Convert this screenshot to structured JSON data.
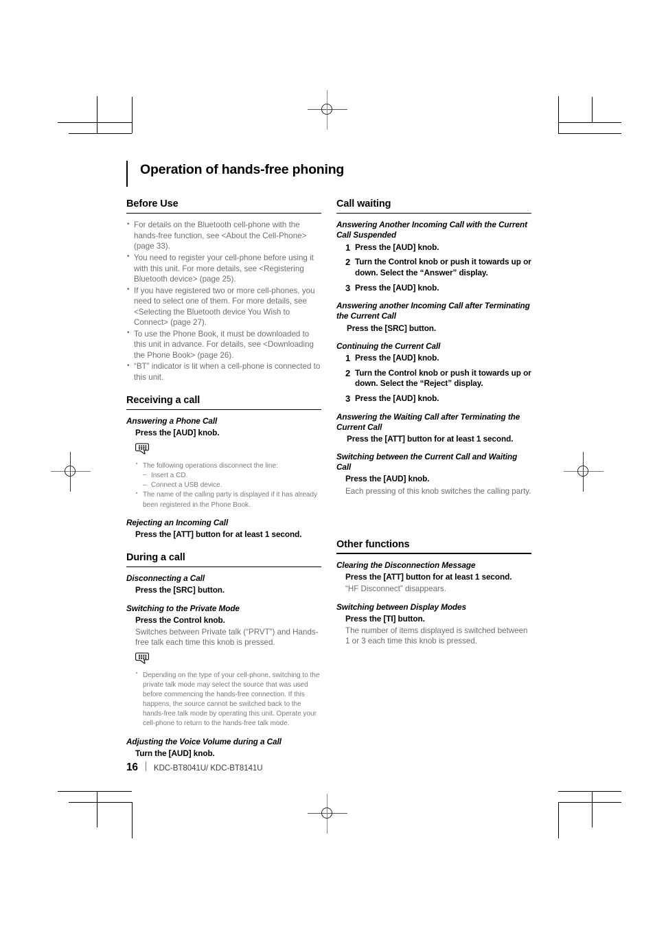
{
  "chapter": {
    "title": "Operation of hands-free phoning"
  },
  "left_column": {
    "before_use": {
      "heading": "Before Use",
      "bullets": [
        "For details on the Bluetooth cell-phone with the hands-free function, see <About the Cell-Phone> (page 33).",
        "You need to register your cell-phone before using it with this unit. For more details, see <Registering Bluetooth device> (page 25).",
        "If you have registered two or more cell-phones, you need to select one of them. For more details, see <Selecting the Bluetooth device You Wish to Connect> (page 27).",
        "To use the Phone Book, it must be downloaded to this unit in advance. For details, see <Downloading the Phone Book> (page 26).",
        "“BT” indicator is lit when a cell-phone is connected to this unit."
      ]
    },
    "receiving_a_call": {
      "heading": "Receiving a call",
      "answering": {
        "sub": "Answering a Phone Call",
        "action": "Press the [AUD] knob.",
        "note_icon": "note-speech-bubble-icon",
        "notes": [
          "The following operations disconnect the line:",
          "The name of the calling party is displayed if it has already been registered in the Phone Book."
        ],
        "note_sub_items": [
          "Insert a CD.",
          "Connect a USB device."
        ]
      },
      "rejecting": {
        "sub": "Rejecting an Incoming Call",
        "action": "Press the [ATT] button for at least 1 second."
      }
    },
    "during_a_call": {
      "heading": "During a call",
      "disconnecting": {
        "sub": "Disconnecting a Call",
        "action": "Press the [SRC] button."
      },
      "private_mode": {
        "sub": "Switching to the Private Mode",
        "action": "Press the Control knob.",
        "desc": "Switches between Private talk (“PRVT”) and Hands-free talk each time this knob is pressed.",
        "note_icon": "note-speech-bubble-icon",
        "notes": [
          "Depending on the type of your cell-phone, switching to the private talk mode may select the source that was used before commencing the hands-free connection. If this happens, the source cannot be switched back to the hands-free talk mode by operating this unit. Operate your cell-phone to return to the hands-free talk mode."
        ]
      },
      "voice_volume": {
        "sub": "Adjusting the Voice Volume during a Call",
        "action": "Turn the [AUD] knob."
      }
    }
  },
  "right_column": {
    "call_waiting": {
      "heading": "Call waiting",
      "answer_suspend": {
        "sub": "Answering Another Incoming Call with the Current Call Suspended",
        "steps": [
          {
            "num": "1",
            "text": "Press the [AUD] knob."
          },
          {
            "num": "2",
            "text": "Turn the Control knob or push it towards up or down. Select the “Answer” display."
          },
          {
            "num": "3",
            "text": "Press the [AUD] knob."
          }
        ]
      },
      "answer_terminate": {
        "sub": "Answering another Incoming Call after Terminating the Current Call",
        "action": "Press the [SRC] button."
      },
      "continuing": {
        "sub": "Continuing the Current Call",
        "steps": [
          {
            "num": "1",
            "text": "Press the [AUD] knob."
          },
          {
            "num": "2",
            "text": "Turn the Control knob or push it towards up or down. Select the “Reject” display."
          },
          {
            "num": "3",
            "text": "Press the [AUD] knob."
          }
        ]
      },
      "waiting_terminate": {
        "sub": "Answering the Waiting Call after Terminating the Current Call",
        "action": "Press the [ATT] button for at least 1 second."
      },
      "switch_calls": {
        "sub": "Switching between the Current Call and Waiting Call",
        "action": "Press the [AUD] knob.",
        "desc": "Each pressing of this knob switches the calling party."
      }
    },
    "other_functions": {
      "heading": "Other functions",
      "clearing": {
        "sub": "Clearing the Disconnection Message",
        "action": "Press the [ATT] button for at least 1 second.",
        "desc": "“HF Disconnect” disappears."
      },
      "display_modes": {
        "sub": "Switching between Display Modes",
        "action": "Press the [TI] button.",
        "desc": "The number of items displayed is switched between 1 or 3 each time this knob is pressed."
      }
    }
  },
  "footer": {
    "page_number": "16",
    "model": "KDC-BT8041U/ KDC-BT8141U"
  }
}
